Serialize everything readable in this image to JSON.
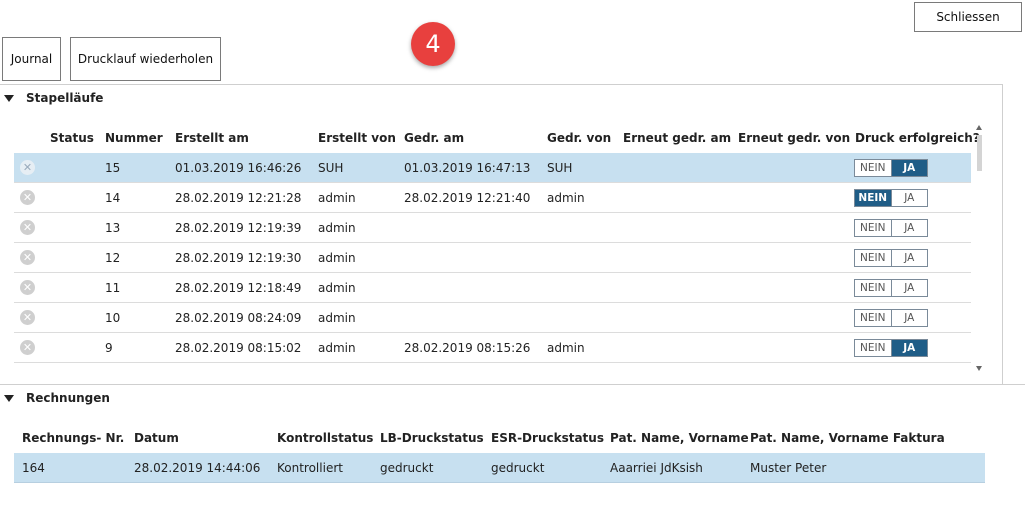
{
  "toolbar": {
    "close_label": "Schliessen",
    "journal_label": "Journal",
    "reprint_label": "Drucklauf wiederholen",
    "step_badge": "4"
  },
  "batches": {
    "title": "Stapelläufe",
    "columns": {
      "status": "Status",
      "number": "Nummer",
      "created_at": "Erstellt am",
      "created_by": "Erstellt von",
      "printed_at": "Gedr. am",
      "printed_by": "Gedr. von",
      "reprinted_at": "Erneut gedr. am",
      "reprinted_by": "Erneut gedr. von",
      "print_ok": "Druck erfolgreich?"
    },
    "toggle_no": "NEIN",
    "toggle_yes": "JA",
    "rows": [
      {
        "number": "15",
        "created_at": "01.03.2019 16:46:26",
        "created_by": "SUH",
        "printed_at": "01.03.2019 16:47:13",
        "printed_by": "SUH",
        "reprinted_at": "",
        "reprinted_by": "",
        "print_ok": "yes",
        "selected": true
      },
      {
        "number": "14",
        "created_at": "28.02.2019 12:21:28",
        "created_by": "admin",
        "printed_at": "28.02.2019 12:21:40",
        "printed_by": "admin",
        "reprinted_at": "",
        "reprinted_by": "",
        "print_ok": "no",
        "selected": false
      },
      {
        "number": "13",
        "created_at": "28.02.2019 12:19:39",
        "created_by": "admin",
        "printed_at": "",
        "printed_by": "",
        "reprinted_at": "",
        "reprinted_by": "",
        "print_ok": "none",
        "selected": false
      },
      {
        "number": "12",
        "created_at": "28.02.2019 12:19:30",
        "created_by": "admin",
        "printed_at": "",
        "printed_by": "",
        "reprinted_at": "",
        "reprinted_by": "",
        "print_ok": "none",
        "selected": false
      },
      {
        "number": "11",
        "created_at": "28.02.2019 12:18:49",
        "created_by": "admin",
        "printed_at": "",
        "printed_by": "",
        "reprinted_at": "",
        "reprinted_by": "",
        "print_ok": "none",
        "selected": false
      },
      {
        "number": "10",
        "created_at": "28.02.2019 08:24:09",
        "created_by": "admin",
        "printed_at": "",
        "printed_by": "",
        "reprinted_at": "",
        "reprinted_by": "",
        "print_ok": "none",
        "selected": false
      },
      {
        "number": "9",
        "created_at": "28.02.2019 08:15:02",
        "created_by": "admin",
        "printed_at": "28.02.2019 08:15:26",
        "printed_by": "admin",
        "reprinted_at": "",
        "reprinted_by": "",
        "print_ok": "yes",
        "selected": false
      }
    ]
  },
  "invoices": {
    "title": "Rechnungen",
    "columns": {
      "invoice_no": "Rechnungs- Nr.",
      "date": "Datum",
      "control_status": "Kontrollstatus",
      "lb_status": "LB-Druckstatus",
      "esr_status": "ESR-Druckstatus",
      "patient": "Pat. Name, Vorname",
      "patient_billing": "Pat. Name, Vorname Faktura"
    },
    "rows": [
      {
        "invoice_no": "164",
        "date": "28.02.2019 14:44:06",
        "control_status": "Kontrolliert",
        "lb_status": "gedruckt",
        "esr_status": "gedruckt",
        "patient": "Aaarriei JdKsish",
        "patient_billing": "Muster Peter"
      }
    ]
  }
}
